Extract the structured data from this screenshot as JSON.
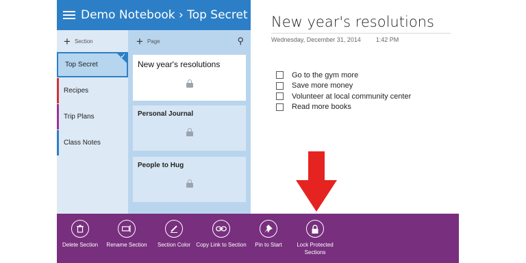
{
  "header": {
    "menu_icon": "hamburger-icon",
    "title": "Demo Notebook › Top Secret",
    "bg_color": "#2c7fc6"
  },
  "sections": {
    "add_label": "Section",
    "items": [
      {
        "label": "Top Secret",
        "color": "#2c7fc6",
        "selected": true
      },
      {
        "label": "Recipes",
        "color": "#d13438"
      },
      {
        "label": "Trip Plans",
        "color": "#9b3294"
      },
      {
        "label": "Class Notes",
        "color": "#2c7fc6"
      }
    ]
  },
  "pages": {
    "add_label": "Page",
    "search_icon": "search-icon",
    "items": [
      {
        "title": "New year's resolutions",
        "locked": true,
        "active": true
      },
      {
        "title": "Personal Journal",
        "locked": true
      },
      {
        "title": "People to Hug",
        "locked": true
      }
    ]
  },
  "note": {
    "title": "New year's resolutions",
    "date": "Wednesday, December 31, 2014",
    "time": "1:42 PM",
    "todos": [
      "Go to the gym more",
      "Save more money",
      "Volunteer at local community center",
      "Read more books"
    ]
  },
  "appbar": {
    "bg_color": "#782f7e",
    "buttons": [
      {
        "label": "Delete Section",
        "icon": "trash-icon"
      },
      {
        "label": "Rename Section",
        "icon": "rename-icon"
      },
      {
        "label": "Section Color",
        "icon": "pen-icon"
      },
      {
        "label": "Copy Link to Section",
        "icon": "link-icon"
      },
      {
        "label": "Pin to Start",
        "icon": "pin-icon"
      },
      {
        "label": "Lock Protected Sections",
        "icon": "lock-icon"
      }
    ]
  },
  "annotation": {
    "arrow_color": "#e52421"
  }
}
